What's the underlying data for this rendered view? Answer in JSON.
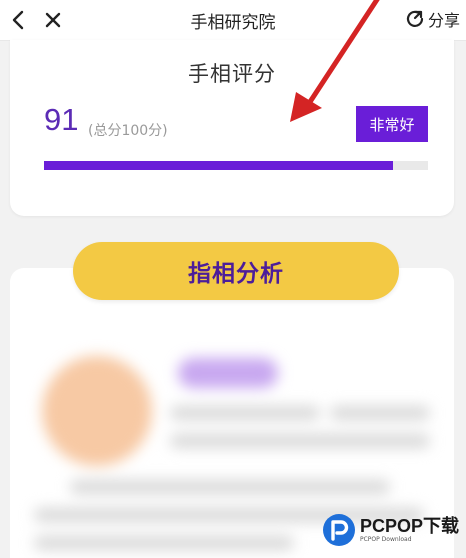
{
  "header": {
    "title": "手相研究院",
    "share_label": "分享"
  },
  "score_card": {
    "title": "手相评分",
    "score": "91",
    "total_note": "(总分100分)",
    "rating_badge": "非常好",
    "progress_fraction": 0.91
  },
  "analysis": {
    "button_label": "指相分析"
  },
  "watermark": {
    "brand": "PCPOP下载",
    "sub": "PCPOP Download"
  },
  "colors": {
    "accent_purple": "#6a1ed8",
    "button_yellow": "#f3c944",
    "annotation_red": "#d42424"
  }
}
